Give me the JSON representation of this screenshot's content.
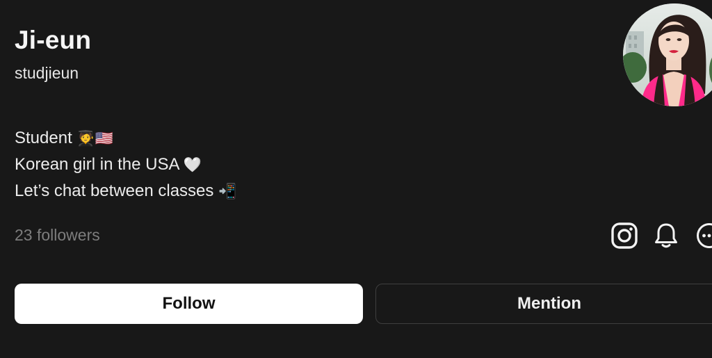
{
  "profile": {
    "display_name": "Ji-eun",
    "username": "studjieun",
    "bio": [
      {
        "text": "Student",
        "emoji": "🧑‍🎓🇺🇸"
      },
      {
        "text": "Korean girl in the USA",
        "emoji": "🤍"
      },
      {
        "text": "Let’s chat between classes",
        "emoji": "📲"
      }
    ],
    "followers_label": "23 followers"
  },
  "icons": [
    "instagram-icon",
    "bell-icon",
    "more-icon"
  ],
  "buttons": {
    "follow_label": "Follow",
    "mention_label": "Mention"
  },
  "colors": {
    "background": "#181818",
    "primary_button": "#ffffff",
    "muted_text": "#7d7d7d",
    "avatar_accent": "#ff2a8a"
  }
}
